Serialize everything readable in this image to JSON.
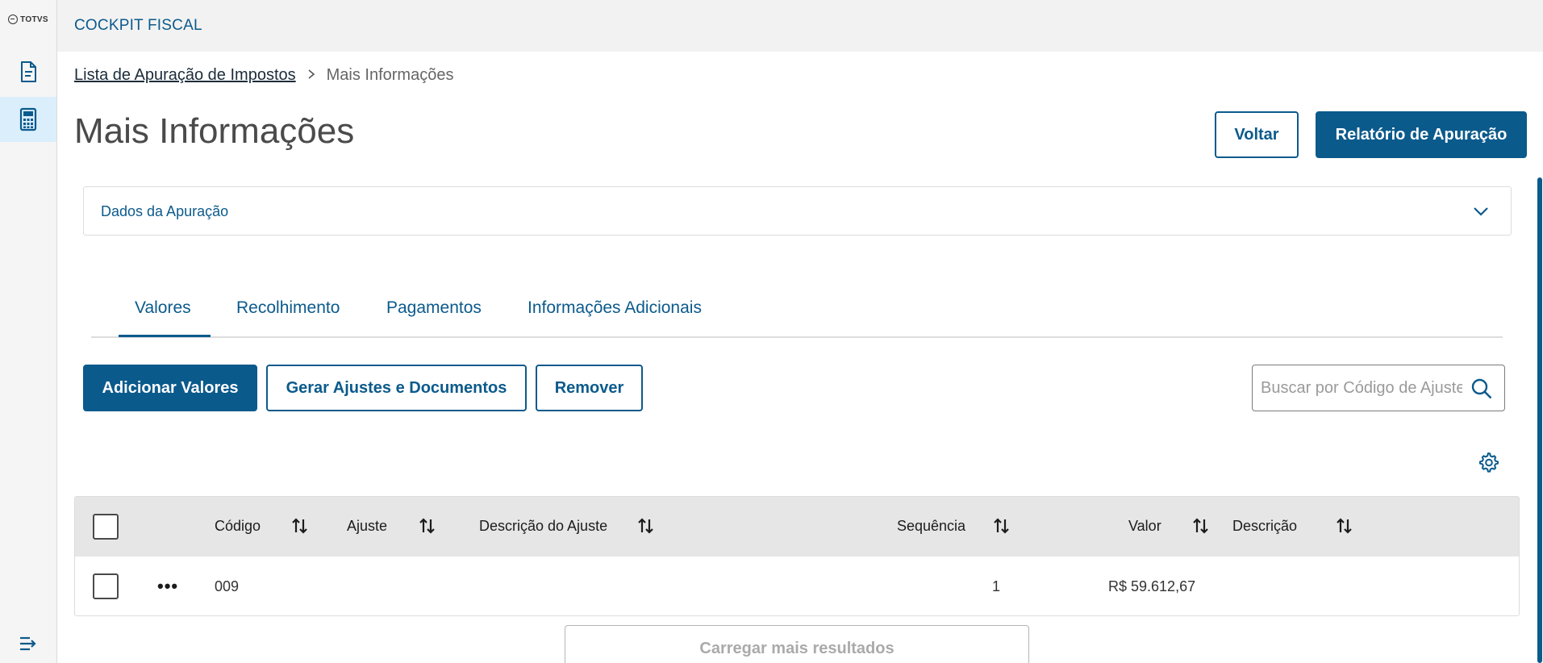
{
  "app": {
    "brand": "TOTVS",
    "header_title": "COCKPIT FISCAL"
  },
  "breadcrumb": {
    "items": [
      {
        "label": "Lista de Apuração de Impostos"
      },
      {
        "label": "Mais Informações"
      }
    ]
  },
  "page": {
    "title": "Mais Informações",
    "back_label": "Voltar",
    "report_label": "Relatório de Apuração"
  },
  "accordion": {
    "label": "Dados da Apuração"
  },
  "tabs": [
    {
      "label": "Valores",
      "active": true
    },
    {
      "label": "Recolhimento",
      "active": false
    },
    {
      "label": "Pagamentos",
      "active": false
    },
    {
      "label": "Informações Adicionais",
      "active": false
    }
  ],
  "actions": {
    "add_label": "Adicionar Valores",
    "generate_label": "Gerar Ajustes e Documentos",
    "remove_label": "Remover"
  },
  "search": {
    "placeholder": "Buscar por Código de Ajuste",
    "value": ""
  },
  "table": {
    "columns": [
      "Código",
      "Ajuste",
      "Descrição do Ajuste",
      "Sequência",
      "Valor",
      "Descrição"
    ],
    "rows": [
      {
        "codigo": "009",
        "ajuste": "",
        "descricao_ajuste": "",
        "sequencia": "1",
        "valor": "R$ 59.612,67",
        "descricao": ""
      }
    ]
  },
  "load_more_label": "Carregar mais resultados",
  "colors": {
    "primary": "#0b5a8c",
    "header_bg": "#f2f2f2",
    "sidebar_active": "#dbeefb"
  }
}
